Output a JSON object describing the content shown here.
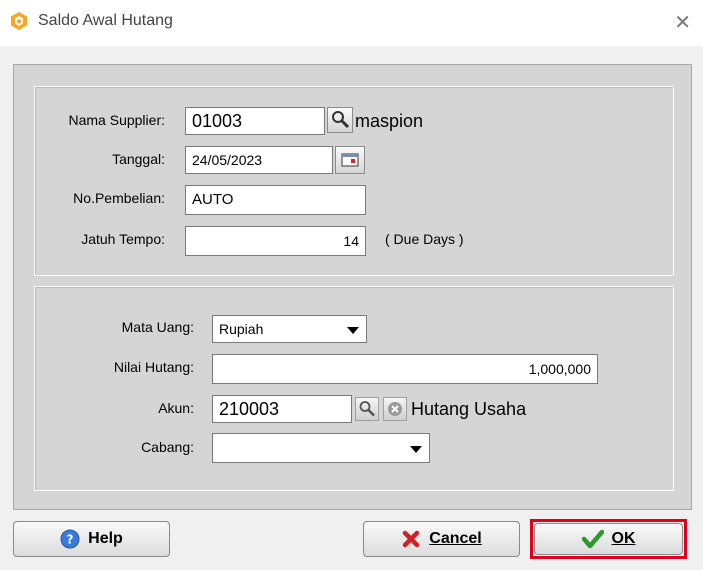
{
  "window": {
    "title": "Saldo Awal Hutang",
    "close_symbol": "✕"
  },
  "supplier": {
    "label": "Nama Supplier:",
    "code": "01003",
    "name": "maspion"
  },
  "tanggal": {
    "label": "Tanggal:",
    "value": "24/05/2023"
  },
  "no_pembelian": {
    "label": "No.Pembelian:",
    "value": "AUTO"
  },
  "jatuh_tempo": {
    "label": "Jatuh Tempo:",
    "value": "14",
    "suffix": "( Due Days )"
  },
  "mata_uang": {
    "label": "Mata Uang:",
    "value": "Rupiah"
  },
  "nilai_hutang": {
    "label": "Nilai Hutang:",
    "value": "1,000,000"
  },
  "akun": {
    "label": "Akun:",
    "code": "210003",
    "name": "Hutang Usaha"
  },
  "cabang": {
    "label": "Cabang:",
    "value": ""
  },
  "buttons": {
    "help": "Help",
    "cancel": "Cancel",
    "ok": "OK"
  },
  "colors": {
    "highlight": "#e0001b",
    "app_icon": "#f5a623"
  }
}
